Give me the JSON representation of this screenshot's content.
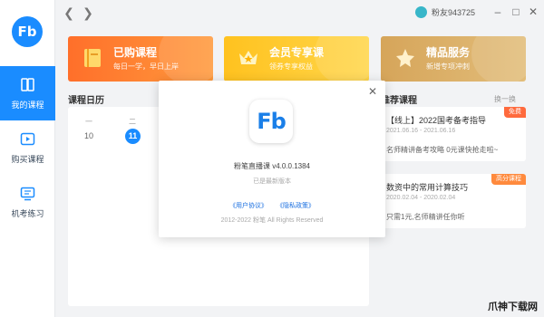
{
  "app": {
    "logo_text": "Fb",
    "user": {
      "name": "粉友943725"
    }
  },
  "sidebar": {
    "items": [
      {
        "label": "我的课程",
        "icon": "book-icon",
        "active": true
      },
      {
        "label": "购买课程",
        "icon": "play-icon",
        "active": false
      },
      {
        "label": "机考练习",
        "icon": "exam-icon",
        "active": false
      }
    ]
  },
  "banners": [
    {
      "title": "已购课程",
      "subtitle": "每日一学，早日上岸",
      "icon": "book-icon",
      "color": "#ff7a2e"
    },
    {
      "title": "会员专享课",
      "subtitle": "领券专享权益",
      "icon": "crown-icon",
      "color": "#ffb71b"
    },
    {
      "title": "精品服务",
      "subtitle": "新增专项冲刺",
      "icon": "diamond-icon",
      "color": "#d4a85a"
    }
  ],
  "calendar": {
    "title": "课程日历",
    "weekdays": [
      "一",
      "二"
    ],
    "days": [
      "10",
      "11"
    ],
    "today": "11"
  },
  "recommend": {
    "title": "推荐课程",
    "more_label": "换一换",
    "courses": [
      {
        "title": "【线上】2022国考备考指导",
        "date": "2021.06.16 - 2021.06.16",
        "desc": "名师精讲备考攻略 0元课快抢走啦~",
        "tag": "免费",
        "tag_color": "#ff6a3d"
      },
      {
        "title": "数资中的常用计算技巧",
        "date": "2020.02.04 - 2020.02.04",
        "desc": "只需1元,名师精讲任你听",
        "tag": "高分课程",
        "tag_color": "#ff8a3d"
      }
    ]
  },
  "modal": {
    "app_icon_text": "Fb",
    "version": "粉笔直播课 v4.0.0.1384",
    "status": "已是最新版本",
    "user_agreement": "《用户协议》",
    "privacy_policy": "《隐私政策》",
    "copyright": "2012-2022 粉笔 All Rights Reserved"
  },
  "watermark": "爪神下载网"
}
